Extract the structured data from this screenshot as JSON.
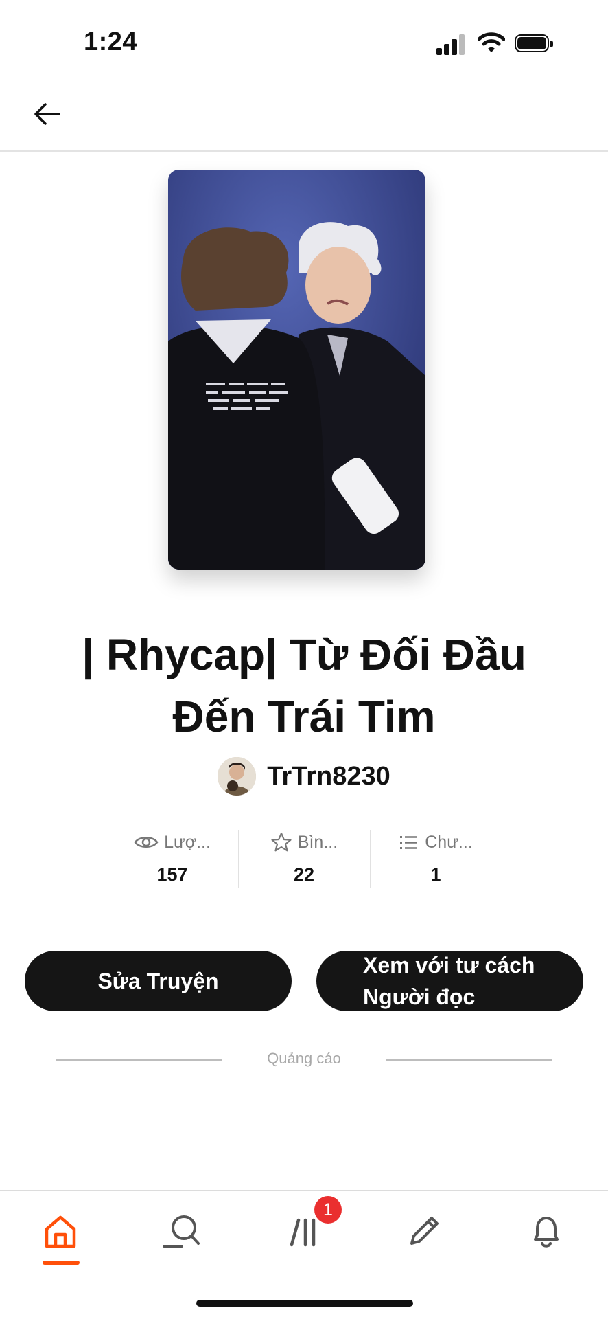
{
  "status_bar": {
    "time": "1:24"
  },
  "story": {
    "title_line1": "| Rhycap| Từ Đối Đầu",
    "title_line2": "Đến Trái Tim",
    "author": "TrTrn8230",
    "stats": [
      {
        "icon": "eye-icon",
        "label": "Lượ...",
        "value": "157"
      },
      {
        "icon": "star-icon",
        "label": "Bìn...",
        "value": "22"
      },
      {
        "icon": "list-icon",
        "label": "Chư...",
        "value": "1"
      }
    ]
  },
  "actions": {
    "edit_label": "Sửa Truyện",
    "read_label_line1": "Xem với tư cách",
    "read_label_line2": "Người đọc"
  },
  "ad": {
    "label": "Quảng cáo"
  },
  "bottom_nav": {
    "items": [
      "home-icon",
      "search-icon",
      "library-icon",
      "pencil-icon",
      "bell-icon"
    ],
    "active": "home",
    "library_badge": "1"
  },
  "colors": {
    "accent": "#ff500a",
    "badge": "#ea2f2f",
    "button": "#151515"
  }
}
